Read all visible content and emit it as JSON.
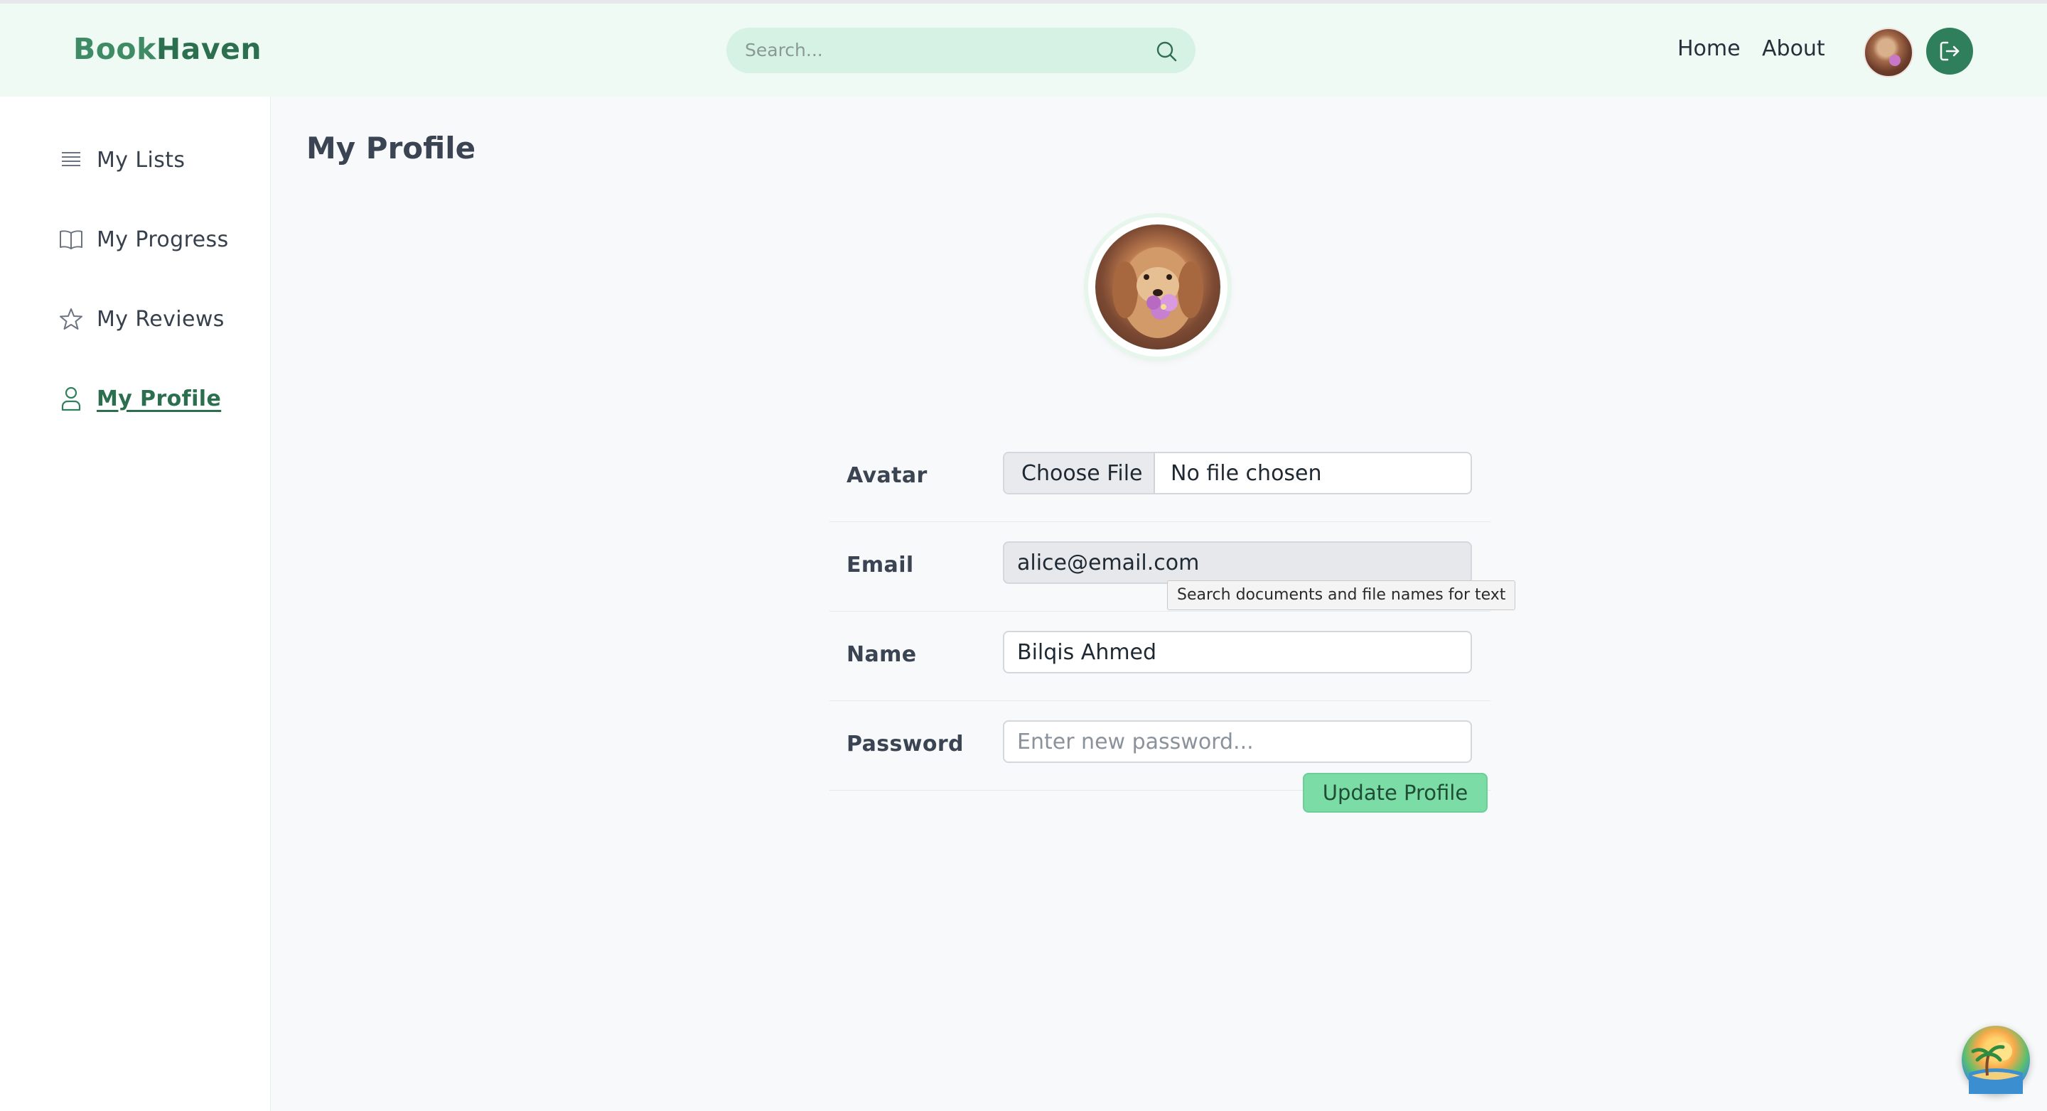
{
  "header": {
    "logo_part1": "Book",
    "logo_part2": "Haven",
    "search_placeholder": "Search...",
    "nav": {
      "home": "Home",
      "about": "About"
    }
  },
  "sidebar": {
    "items": [
      {
        "label": "My Lists",
        "icon": "list-icon"
      },
      {
        "label": "My Progress",
        "icon": "book-open-icon"
      },
      {
        "label": "My Reviews",
        "icon": "star-icon"
      },
      {
        "label": "My Profile",
        "icon": "user-icon",
        "active": true
      }
    ]
  },
  "main": {
    "title": "My Profile",
    "form": {
      "avatar": {
        "label": "Avatar",
        "button": "Choose File",
        "status": "No file chosen"
      },
      "email": {
        "label": "Email",
        "value": "alice@email.com"
      },
      "name": {
        "label": "Name",
        "value": "Bilqis Ahmed"
      },
      "password": {
        "label": "Password",
        "placeholder": "Enter new password..."
      },
      "submit": "Update Profile"
    },
    "tooltip": "Search documents and file names for text"
  },
  "colors": {
    "brand": "#2b6f4f",
    "header_bg": "#effaf5",
    "accent_button": "#7bdca6"
  }
}
